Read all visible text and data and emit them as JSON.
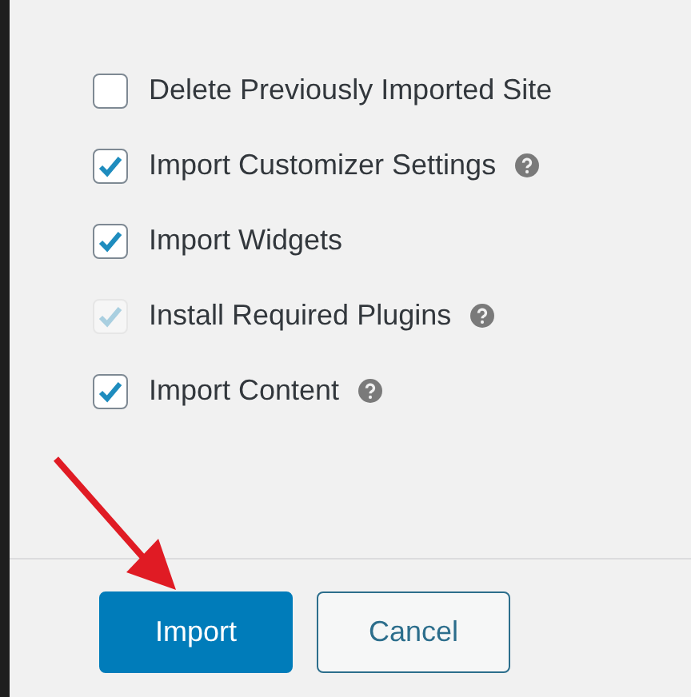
{
  "options": [
    {
      "label": "Delete Previously Imported Site",
      "checked": false,
      "disabled": false,
      "help": false
    },
    {
      "label": "Import Customizer Settings",
      "checked": true,
      "disabled": false,
      "help": true
    },
    {
      "label": "Import Widgets",
      "checked": true,
      "disabled": false,
      "help": false
    },
    {
      "label": "Install Required Plugins",
      "checked": true,
      "disabled": true,
      "help": true
    },
    {
      "label": "Import Content",
      "checked": true,
      "disabled": false,
      "help": true
    }
  ],
  "buttons": [
    {
      "label": "Import",
      "kind": "primary"
    },
    {
      "label": "Cancel",
      "kind": "secondary"
    }
  ]
}
